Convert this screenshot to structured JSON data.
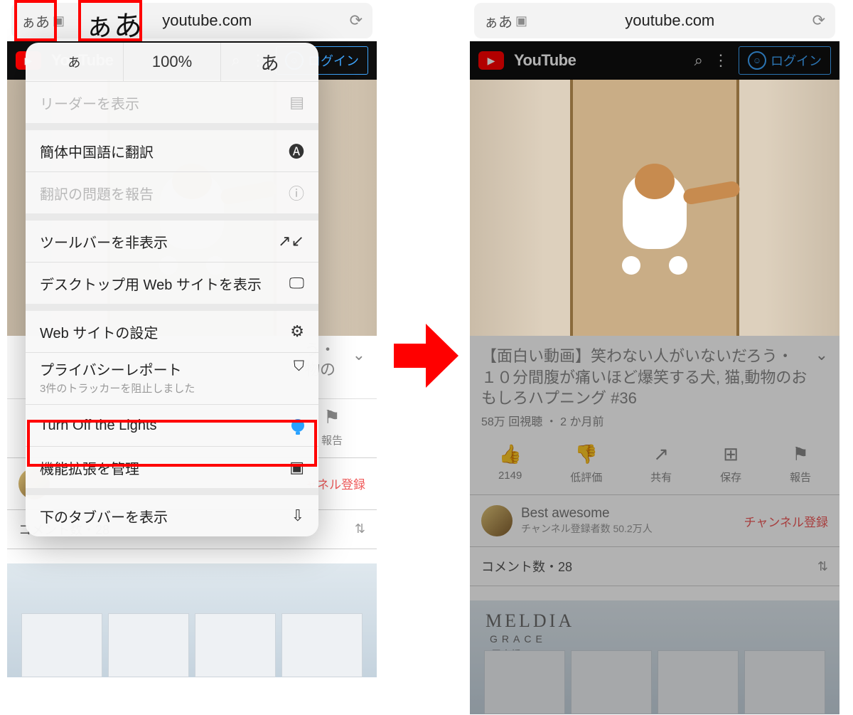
{
  "addr": {
    "aa": "ぁあ",
    "url": "youtube.com"
  },
  "ythead": {
    "brand": "YouTube",
    "login": "ログイン"
  },
  "video": {
    "title": "【面白い動画】笑わない人がいないだろう・１０分間腹が痛いほど爆笑する犬, 猫,動物のおもしろハプニング #36",
    "views": "58万 回視聴",
    "age": "2 か月前"
  },
  "actions": {
    "likes": "2149",
    "dislike": "低評価",
    "share": "共有",
    "save": "保存",
    "report": "報告"
  },
  "channel": {
    "name": "Best awesome",
    "subs": "チャンネル登録者数 50.2万人",
    "subscribe": "チャンネル登録"
  },
  "comments": {
    "label": "コメント数",
    "count": "28"
  },
  "ad": {
    "brand": "MELDIA",
    "sub": "GRACE",
    "loc": "尾大橋"
  },
  "popup": {
    "zoom": {
      "small": "あ",
      "pct": "100%",
      "large": "あ"
    },
    "reader": "リーダーを表示",
    "translate": "簡体中国語に翻訳",
    "translate_report": "翻訳の問題を報告",
    "hide_toolbar": "ツールバーを非表示",
    "desktop": "デスクトップ用 Web サイトを表示",
    "site_settings": "Web サイトの設定",
    "privacy_title": "プライバシーレポート",
    "privacy_sub": "3件のトラッカーを阻止しました",
    "extension": "Turn Off the Lights",
    "manage_ext": "機能拡張を管理",
    "bottom_tab": "下のタブバーを表示"
  },
  "left_visible": {
    "title_frag": "う・",
    "title_frag2": "物の",
    "report": "報告",
    "subscribe_frag": "ャネル登録"
  },
  "float_aa": "ぁあ"
}
